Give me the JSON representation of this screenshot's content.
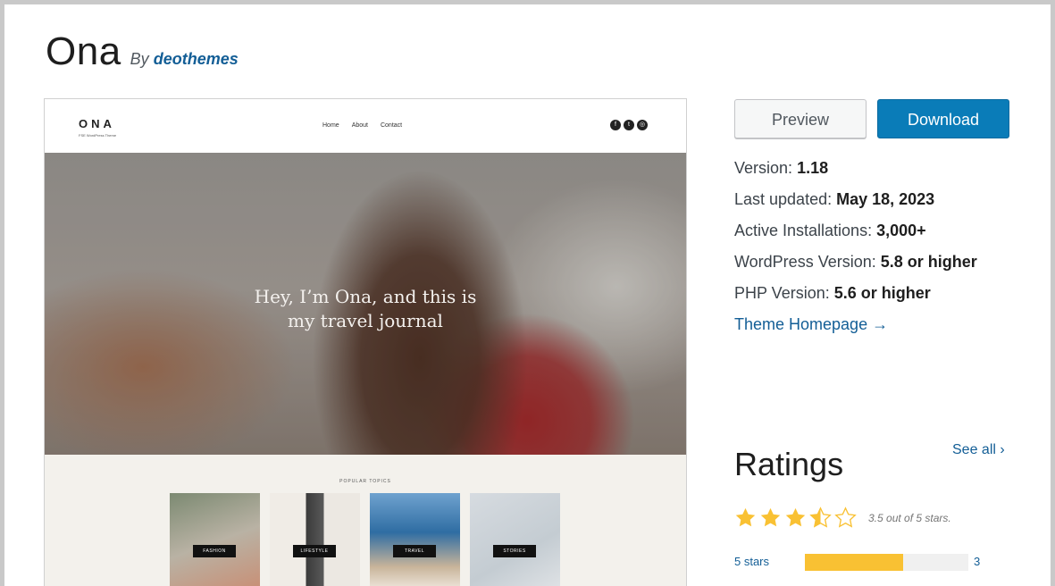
{
  "theme": {
    "name": "Ona",
    "by_label": "By",
    "author": "deothemes"
  },
  "screenshot": {
    "logo": "ONA",
    "tagline": "FSE WordPress Theme",
    "nav": [
      "Home",
      "About",
      "Contact"
    ],
    "social_icons": [
      "facebook-icon",
      "twitter-icon",
      "instagram-icon"
    ],
    "hero_line1": "Hey, I’m Ona, and this is",
    "hero_line2": "my travel journal",
    "popular_title": "POPULAR TOPICS",
    "cards": [
      "FASHION",
      "LIFESTYLE",
      "TRAVEL",
      "STORIES"
    ]
  },
  "actions": {
    "preview": "Preview",
    "download": "Download"
  },
  "meta": {
    "version_label": "Version:",
    "version": "1.18",
    "updated_label": "Last updated:",
    "updated": "May 18, 2023",
    "installs_label": "Active Installations:",
    "installs": "3,000+",
    "wp_label": "WordPress Version:",
    "wp": "5.8 or higher",
    "php_label": "PHP Version:",
    "php": "5.6 or higher",
    "homepage": "Theme Homepage →"
  },
  "ratings": {
    "heading": "Ratings",
    "see_all": "See all",
    "rating": 3.5,
    "stars_text": "3.5 out of 5 stars.",
    "rows": [
      {
        "label": "5 stars",
        "count": "3",
        "fraction": 0.6
      }
    ]
  },
  "colors": {
    "accent": "#0a7cb8",
    "link": "#135e96",
    "star": "#f9c133",
    "bar": "#f9c133"
  }
}
